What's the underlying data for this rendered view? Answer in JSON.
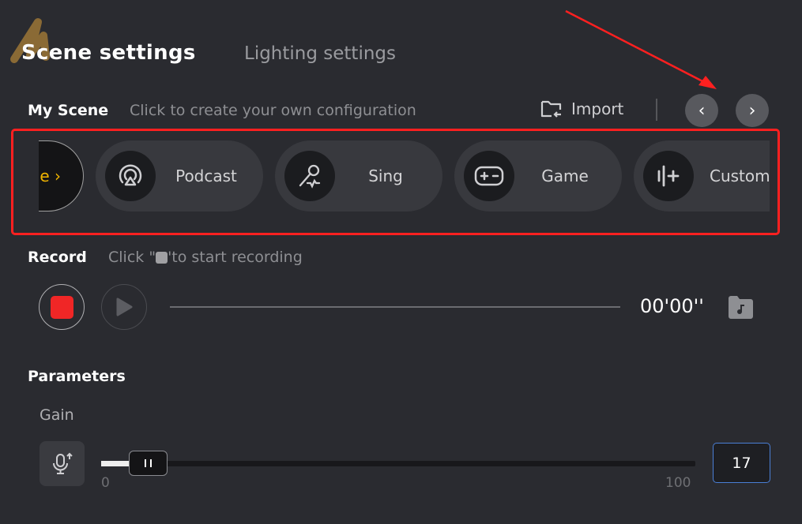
{
  "logo": {
    "text": "M"
  },
  "tabs": [
    {
      "label": "Scene settings",
      "active": true
    },
    {
      "label": "Lighting settings",
      "active": false
    }
  ],
  "my_scene": {
    "title": "My Scene",
    "hint": "Click to create your own configuration",
    "import_label": "Import",
    "partial_item": {
      "label": "e",
      "chevron": "›"
    },
    "items": [
      {
        "label": "Podcast",
        "icon": "podcast-icon"
      },
      {
        "label": "Sing",
        "icon": "microphone-icon"
      },
      {
        "label": "Game",
        "icon": "gamepad-icon"
      },
      {
        "label": "Custom",
        "icon": "custom-add-icon"
      }
    ]
  },
  "record": {
    "title": "Record",
    "hint_prefix": "Click \"",
    "hint_suffix": "'to start recording",
    "time": "00'00''"
  },
  "parameters": {
    "title": "Parameters",
    "gain": {
      "label": "Gain",
      "value": "17",
      "min": "0",
      "max": "100"
    }
  },
  "colors": {
    "accent_red": "#ff2020",
    "stop_red": "#f02626",
    "input_border": "#4a7fd6",
    "chevron_yellow": "#f0b400"
  }
}
